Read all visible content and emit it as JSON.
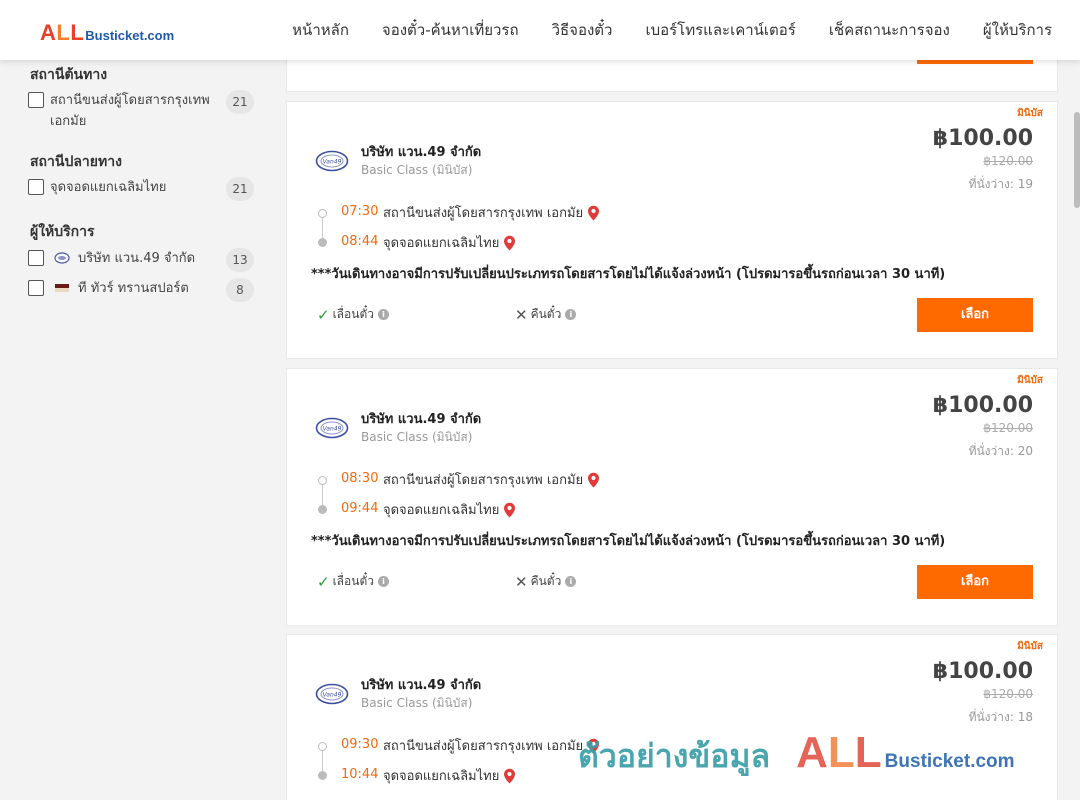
{
  "header": {
    "logo_all": [
      "A",
      "L",
      "L"
    ],
    "logo_rest": "Busticket.com",
    "nav": [
      "หน้าหลัก",
      "จองตั๋ว-ค้นหาเที่ยวรถ",
      "วิธีจองตั๋ว",
      "เบอร์โทรและเคาน์เตอร์",
      "เช็คสถานะการจอง",
      "ผู้ให้บริการ"
    ]
  },
  "sidebar": {
    "origin": {
      "title": "สถานีต้นทาง",
      "items": [
        {
          "line1": "สถานีขนส่งผู้โดยสารกรุงเทพ",
          "line2": "เอกมัย",
          "count": "21"
        }
      ]
    },
    "destination": {
      "title": "สถานีปลายทาง",
      "items": [
        {
          "label": "จุดจอดแยกเฉลิมไทย",
          "count": "21"
        }
      ]
    },
    "providers": {
      "title": "ผู้ให้บริการ",
      "items": [
        {
          "label": "บริษัท แวน.49 จำกัด",
          "count": "13"
        },
        {
          "label": "ที ทัวร์ ทรานสปอร์ต",
          "count": "8"
        }
      ]
    }
  },
  "trips": [
    {
      "tag": "มินิบัส",
      "company": "บริษัท แวน.49 จำกัด",
      "class": "Basic Class (มินิบัส)",
      "price": "฿100.00",
      "old_price": "฿120.00",
      "seats": "ที่นั่งว่าง: 19",
      "depart_time": "07:30",
      "depart_place": "สถานีขนส่งผู้โดยสารกรุงเทพ เอกมัย",
      "arrive_time": "08:44",
      "arrive_place": "จุดจอดแยกเฉลิมไทย",
      "note": "***วันเดินทางอาจมีการปรับเปลี่ยนประเภทรถโดยสารโดยไม่ได้แจ้งล่วงหน้า (โปรดมารอขึ้นรถก่อนเวลา 30 นาที)",
      "postpone": "เลื่อนตั๋ว",
      "refund": "คืนตั๋ว",
      "select": "เลือก"
    },
    {
      "tag": "มินิบัส",
      "company": "บริษัท แวน.49 จำกัด",
      "class": "Basic Class (มินิบัส)",
      "price": "฿100.00",
      "old_price": "฿120.00",
      "seats": "ที่นั่งว่าง: 20",
      "depart_time": "08:30",
      "depart_place": "สถานีขนส่งผู้โดยสารกรุงเทพ เอกมัย",
      "arrive_time": "09:44",
      "arrive_place": "จุดจอดแยกเฉลิมไทย",
      "note": "***วันเดินทางอาจมีการปรับเปลี่ยนประเภทรถโดยสารโดยไม่ได้แจ้งล่วงหน้า (โปรดมารอขึ้นรถก่อนเวลา 30 นาที)",
      "postpone": "เลื่อนตั๋ว",
      "refund": "คืนตั๋ว",
      "select": "เลือก"
    },
    {
      "tag": "มินิบัส",
      "company": "บริษัท แวน.49 จำกัด",
      "class": "Basic Class (มินิบัส)",
      "price": "฿100.00",
      "old_price": "฿120.00",
      "seats": "ที่นั่งว่าง: 18",
      "depart_time": "09:30",
      "depart_place": "สถานีขนส่งผู้โดยสารกรุงเทพ เอกมัย",
      "arrive_time": "10:44",
      "arrive_place": "จุดจอดแยกเฉลิมไทย",
      "note": "",
      "postpone": "",
      "refund": "",
      "select": ""
    }
  ],
  "watermark": {
    "thai": "ตัวอย่างข้อมูล",
    "all": [
      "A",
      "L",
      "L"
    ],
    "rest": "Busticket.com"
  },
  "colors": {
    "accent": "#ff6a00",
    "time": "#f26a10",
    "brand_blue": "#1f5aa8"
  },
  "icons": [
    "map-pin-icon",
    "check-icon",
    "x-icon",
    "info-icon",
    "van-company-logo-icon",
    "tt-transport-logo-icon"
  ]
}
